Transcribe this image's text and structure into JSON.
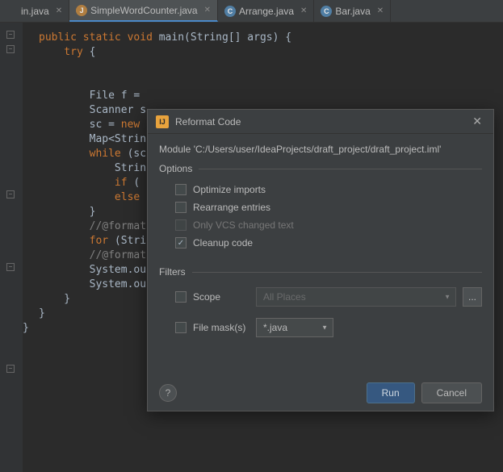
{
  "tabs": [
    {
      "label": "in.java"
    },
    {
      "label": "SimpleWordCounter.java"
    },
    {
      "label": "Arrange.java"
    },
    {
      "label": "Bar.java"
    }
  ],
  "code": {
    "line1a": "public",
    "line1b": " static",
    "line1c": " void",
    "line1d": " main(String[] args) {",
    "line2a": "    try",
    "line2b": " {",
    "line3": "",
    "line4": "",
    "line5": "        File f = ",
    "line6": "        Scanner s",
    "line7a": "        sc = ",
    "line7b": "new",
    "line8": "        Map<Strin",
    "line9a": "        while",
    "line9b": " (sc",
    "line10": "            Strin",
    "line11a": "            if",
    "line11b": " (",
    "line12a": "            else",
    "line13": "        }",
    "line14": "        //@format",
    "line15a": "        for",
    "line15b": " (Stri",
    "line16": "        //@format",
    "line17": "        System.ou",
    "line18": "        System.ou",
    "line19": "    }",
    "line20": "}",
    "closebrace": "}"
  },
  "dialog": {
    "title": "Reformat Code",
    "module": "Module 'C:/Users/user/IdeaProjects/draft_project/draft_project.iml'",
    "optionsTitle": "Options",
    "optimizeImports": "Optimize imports",
    "rearrangeEntries": "Rearrange entries",
    "onlyVcs": "Only VCS changed text",
    "cleanupCode": "Cleanup code",
    "filtersTitle": "Filters",
    "scopeLabel": "Scope",
    "scopeValue": "All Places",
    "fileMaskLabel": "File mask(s)",
    "fileMaskValue": "*.java",
    "ellipsis": "...",
    "runLabel": "Run",
    "cancelLabel": "Cancel",
    "helpLabel": "?"
  }
}
